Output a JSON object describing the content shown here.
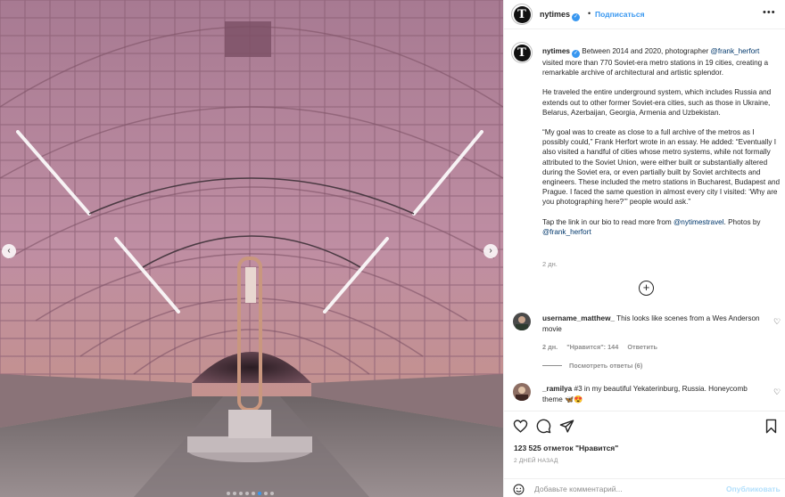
{
  "header": {
    "username": "nytimes",
    "separator": "•",
    "follow_label": "Подписаться",
    "more_label": "•••"
  },
  "caption": {
    "username": "nytimes",
    "p1_a": "Between 2014 and 2020, photographer ",
    "p1_mention": "@frank_herfort",
    "p1_b": " visited more than 770 Soviet-era metro stations in 19 cities, creating a remarkable archive of architectural and artistic splendor.",
    "p2": "He traveled the entire underground system, which includes Russia and extends out to other former Soviet-era cities, such as those in Ukraine, Belarus, Azerbaijan, Georgia, Armenia and Uzbekistan.",
    "p3": "“My goal was to create as close to a full archive of the metros as I possibly could,” Frank Herfort wrote in an essay. He added: “Eventually I also visited a handful of cities whose metro systems, while not formally attributed to the Soviet Union, were either built or substantially altered during the Soviet era, or even partially built by Soviet architects and engineers. These included the metro stations in Bucharest, Budapest and Prague. I faced the same question in almost every city I visited: ‘Why are you photographing here?’” people would ask.”",
    "p4_a": "Tap the link in our bio to read more from ",
    "p4_mention1": "@nytimestravel",
    "p4_b": ". Photos by ",
    "p4_mention2": "@frank_herfort",
    "time": "2 дн."
  },
  "load_more_label": "+",
  "comments": [
    {
      "username": "username_matthew_",
      "text": " This looks like scenes from a Wes Anderson movie",
      "time": "2 дн.",
      "likes": "\"Нравится\": 144",
      "reply": "Ответить",
      "view_replies": "Посмотреть ответы (6)"
    },
    {
      "username": "_ramilya",
      "text": " #3 in my beautiful Yekaterinburg, Russia. Honeycomb theme 🦋😍"
    }
  ],
  "actions": {
    "likes": "123 525 отметок \"Нравится\"",
    "ago": "2 ДНЕЙ НАЗАД"
  },
  "comment_box": {
    "placeholder": "Добавьте комментарий...",
    "publish_label": "Опубликовать"
  },
  "carousel": {
    "prev_label": "‹",
    "next_label": "›",
    "total_slides": 8,
    "active_slide": 6
  },
  "colors": {
    "accent": "#3897f0",
    "link": "#00376b",
    "muted": "#8e8e8e",
    "vault": "#b07f98",
    "floor": "#8c7e80"
  }
}
